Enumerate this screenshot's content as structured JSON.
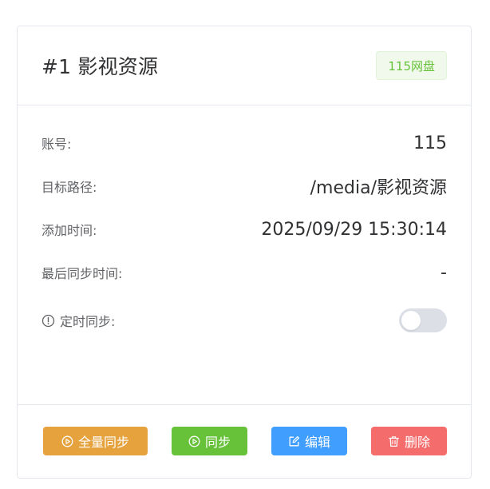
{
  "card": {
    "title": "#1 影视资源",
    "tag": "115网盘",
    "tag_color": "#67c23a"
  },
  "fields": {
    "account_label": "账号:",
    "account_value": "115",
    "target_path_label": "目标路径:",
    "target_path_value": "/media/影视资源",
    "added_time_label": "添加时间:",
    "added_time_value": "2025/09/29 15:30:14",
    "last_sync_label": "最后同步时间:",
    "last_sync_value": "-",
    "scheduled_sync_label": "定时同步:",
    "scheduled_sync_enabled": false,
    "scheduled_sync_icon": "info-circle-icon"
  },
  "actions": {
    "full_sync_label": "全量同步",
    "full_sync_icon": "play-circle-icon",
    "full_sync_color": "#e6a23c",
    "sync_label": "同步",
    "sync_icon": "play-circle-icon",
    "sync_color": "#67c23a",
    "edit_label": "编辑",
    "edit_icon": "edit-icon",
    "edit_color": "#409eff",
    "delete_label": "删除",
    "delete_icon": "trash-icon",
    "delete_color": "#f56c6c"
  }
}
